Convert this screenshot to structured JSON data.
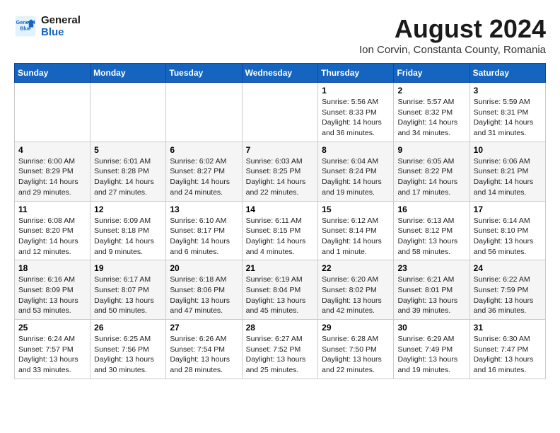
{
  "header": {
    "logo_line1": "General",
    "logo_line2": "Blue",
    "month_year": "August 2024",
    "location": "Ion Corvin, Constanta County, Romania"
  },
  "weekdays": [
    "Sunday",
    "Monday",
    "Tuesday",
    "Wednesday",
    "Thursday",
    "Friday",
    "Saturday"
  ],
  "weeks": [
    [
      {
        "day": "",
        "info": ""
      },
      {
        "day": "",
        "info": ""
      },
      {
        "day": "",
        "info": ""
      },
      {
        "day": "",
        "info": ""
      },
      {
        "day": "1",
        "info": "Sunrise: 5:56 AM\nSunset: 8:33 PM\nDaylight: 14 hours\nand 36 minutes."
      },
      {
        "day": "2",
        "info": "Sunrise: 5:57 AM\nSunset: 8:32 PM\nDaylight: 14 hours\nand 34 minutes."
      },
      {
        "day": "3",
        "info": "Sunrise: 5:59 AM\nSunset: 8:31 PM\nDaylight: 14 hours\nand 31 minutes."
      }
    ],
    [
      {
        "day": "4",
        "info": "Sunrise: 6:00 AM\nSunset: 8:29 PM\nDaylight: 14 hours\nand 29 minutes."
      },
      {
        "day": "5",
        "info": "Sunrise: 6:01 AM\nSunset: 8:28 PM\nDaylight: 14 hours\nand 27 minutes."
      },
      {
        "day": "6",
        "info": "Sunrise: 6:02 AM\nSunset: 8:27 PM\nDaylight: 14 hours\nand 24 minutes."
      },
      {
        "day": "7",
        "info": "Sunrise: 6:03 AM\nSunset: 8:25 PM\nDaylight: 14 hours\nand 22 minutes."
      },
      {
        "day": "8",
        "info": "Sunrise: 6:04 AM\nSunset: 8:24 PM\nDaylight: 14 hours\nand 19 minutes."
      },
      {
        "day": "9",
        "info": "Sunrise: 6:05 AM\nSunset: 8:22 PM\nDaylight: 14 hours\nand 17 minutes."
      },
      {
        "day": "10",
        "info": "Sunrise: 6:06 AM\nSunset: 8:21 PM\nDaylight: 14 hours\nand 14 minutes."
      }
    ],
    [
      {
        "day": "11",
        "info": "Sunrise: 6:08 AM\nSunset: 8:20 PM\nDaylight: 14 hours\nand 12 minutes."
      },
      {
        "day": "12",
        "info": "Sunrise: 6:09 AM\nSunset: 8:18 PM\nDaylight: 14 hours\nand 9 minutes."
      },
      {
        "day": "13",
        "info": "Sunrise: 6:10 AM\nSunset: 8:17 PM\nDaylight: 14 hours\nand 6 minutes."
      },
      {
        "day": "14",
        "info": "Sunrise: 6:11 AM\nSunset: 8:15 PM\nDaylight: 14 hours\nand 4 minutes."
      },
      {
        "day": "15",
        "info": "Sunrise: 6:12 AM\nSunset: 8:14 PM\nDaylight: 14 hours\nand 1 minute."
      },
      {
        "day": "16",
        "info": "Sunrise: 6:13 AM\nSunset: 8:12 PM\nDaylight: 13 hours\nand 58 minutes."
      },
      {
        "day": "17",
        "info": "Sunrise: 6:14 AM\nSunset: 8:10 PM\nDaylight: 13 hours\nand 56 minutes."
      }
    ],
    [
      {
        "day": "18",
        "info": "Sunrise: 6:16 AM\nSunset: 8:09 PM\nDaylight: 13 hours\nand 53 minutes."
      },
      {
        "day": "19",
        "info": "Sunrise: 6:17 AM\nSunset: 8:07 PM\nDaylight: 13 hours\nand 50 minutes."
      },
      {
        "day": "20",
        "info": "Sunrise: 6:18 AM\nSunset: 8:06 PM\nDaylight: 13 hours\nand 47 minutes."
      },
      {
        "day": "21",
        "info": "Sunrise: 6:19 AM\nSunset: 8:04 PM\nDaylight: 13 hours\nand 45 minutes."
      },
      {
        "day": "22",
        "info": "Sunrise: 6:20 AM\nSunset: 8:02 PM\nDaylight: 13 hours\nand 42 minutes."
      },
      {
        "day": "23",
        "info": "Sunrise: 6:21 AM\nSunset: 8:01 PM\nDaylight: 13 hours\nand 39 minutes."
      },
      {
        "day": "24",
        "info": "Sunrise: 6:22 AM\nSunset: 7:59 PM\nDaylight: 13 hours\nand 36 minutes."
      }
    ],
    [
      {
        "day": "25",
        "info": "Sunrise: 6:24 AM\nSunset: 7:57 PM\nDaylight: 13 hours\nand 33 minutes."
      },
      {
        "day": "26",
        "info": "Sunrise: 6:25 AM\nSunset: 7:56 PM\nDaylight: 13 hours\nand 30 minutes."
      },
      {
        "day": "27",
        "info": "Sunrise: 6:26 AM\nSunset: 7:54 PM\nDaylight: 13 hours\nand 28 minutes."
      },
      {
        "day": "28",
        "info": "Sunrise: 6:27 AM\nSunset: 7:52 PM\nDaylight: 13 hours\nand 25 minutes."
      },
      {
        "day": "29",
        "info": "Sunrise: 6:28 AM\nSunset: 7:50 PM\nDaylight: 13 hours\nand 22 minutes."
      },
      {
        "day": "30",
        "info": "Sunrise: 6:29 AM\nSunset: 7:49 PM\nDaylight: 13 hours\nand 19 minutes."
      },
      {
        "day": "31",
        "info": "Sunrise: 6:30 AM\nSunset: 7:47 PM\nDaylight: 13 hours\nand 16 minutes."
      }
    ]
  ]
}
